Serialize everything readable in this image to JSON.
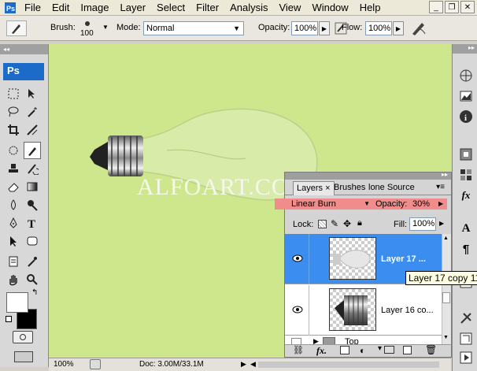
{
  "menubar": {
    "items": [
      "File",
      "Edit",
      "Image",
      "Layer",
      "Select",
      "Filter",
      "Analysis",
      "View",
      "Window",
      "Help"
    ]
  },
  "options": {
    "brush_label": "Brush:",
    "brush_size": "100",
    "mode_label": "Mode:",
    "mode_value": "Normal",
    "opacity_label": "Opacity:",
    "opacity_value": "100%",
    "flow_label": "Flow:",
    "flow_value": "100%"
  },
  "toolbar": {
    "logo": "Ps"
  },
  "canvas": {
    "background": "#cfe78c",
    "watermark": "ALFOART.COM"
  },
  "status": {
    "zoom": "100%",
    "doc": "Doc: 3.00M/33.1M"
  },
  "layers_panel": {
    "tabs": [
      "Layers",
      "Brushes",
      "lone Source"
    ],
    "tab_close": "×",
    "blend_mode": "Linear Burn",
    "opacity_label": "Opacity:",
    "opacity_value": "30%",
    "lock_label": "Lock:",
    "fill_label": "Fill:",
    "fill_value": "100%",
    "layers": [
      {
        "name": "Layer 17 ...",
        "selected": true
      },
      {
        "name": "Layer 16 co...",
        "selected": false
      },
      {
        "name": "Top",
        "selected": false
      }
    ],
    "selected_color": "#3b8ef0",
    "blend_highlight_color": "#f08c8c"
  },
  "tooltip": "Layer 17 copy 11"
}
